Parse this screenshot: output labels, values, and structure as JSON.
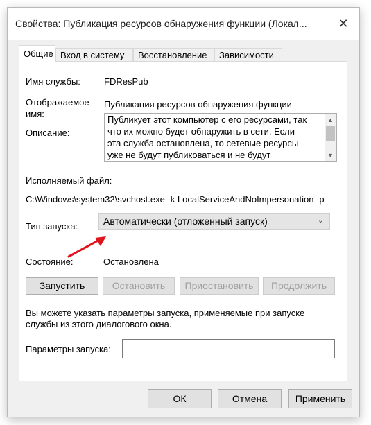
{
  "window": {
    "title": "Свойства: Публикация ресурсов обнаружения функции (Локал...",
    "close_glyph": "✕"
  },
  "tabs": [
    {
      "label": "Общие"
    },
    {
      "label": "Вход в систему"
    },
    {
      "label": "Восстановление"
    },
    {
      "label": "Зависимости"
    }
  ],
  "general": {
    "service_name_label": "Имя службы:",
    "service_name_value": "FDResPub",
    "display_name_label_1": "Отображаемое",
    "display_name_label_2": "имя:",
    "display_name_value": "Публикация ресурсов обнаружения функции",
    "description_label": "Описание:",
    "description_lines": [
      "Публикует этот компьютер с его ресурсами, так",
      "что их можно будет обнаружить в сети.  Если",
      "эта служба остановлена, то сетевые ресурсы",
      "уже не будут публиковаться и не будут"
    ],
    "exe_label": "Исполняемый файл:",
    "exe_value": "C:\\Windows\\system32\\svchost.exe -k LocalServiceAndNoImpersonation -p",
    "startup_type_label": "Тип запуска:",
    "startup_type_value": "Автоматически (отложенный запуск)",
    "status_label": "Состояние:",
    "status_value": "Остановлена",
    "buttons": {
      "start": "Запустить",
      "stop": "Остановить",
      "pause": "Приостановить",
      "resume": "Продолжить"
    },
    "hint_line_1": "Вы можете указать параметры запуска, применяемые при запуске",
    "hint_line_2": "службы из этого диалогового окна.",
    "start_params_label": "Параметры запуска:",
    "start_params_value": ""
  },
  "footer": {
    "ok": "ОК",
    "cancel": "Отмена",
    "apply": "Применить"
  },
  "colors": {
    "annotation_arrow": "#e0141e"
  }
}
